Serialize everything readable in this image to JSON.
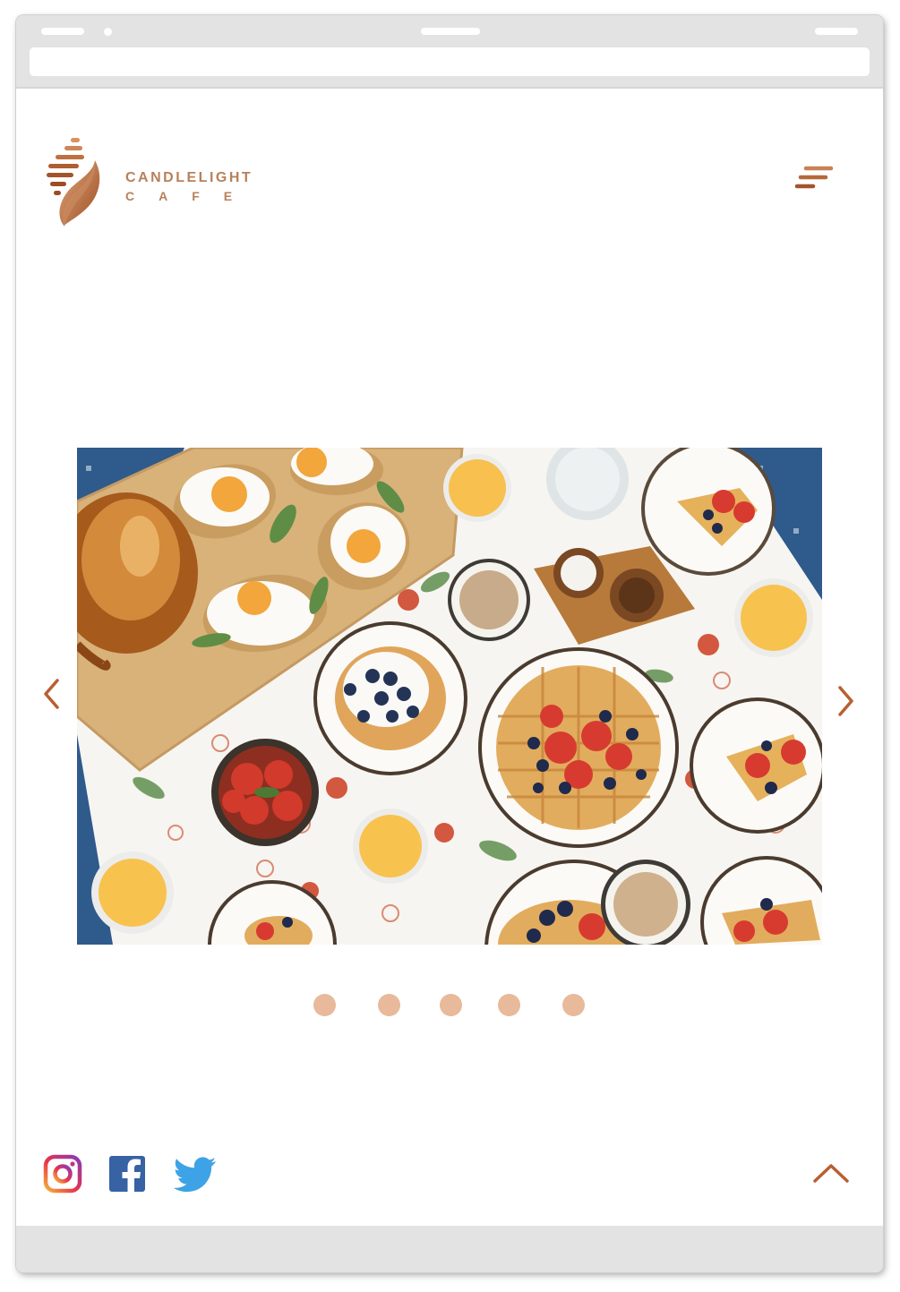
{
  "brand": {
    "name_line1": "CANDLELIGHT",
    "name_line2": "CAFE",
    "accent_color": "#b8815b",
    "dark_accent": "#a0552a"
  },
  "header": {
    "menu_icon": "hamburger-menu-icon"
  },
  "carousel": {
    "prev_icon": "chevron-left-icon",
    "next_icon": "chevron-right-icon",
    "slide_count": 5,
    "dot_color": "#e8b99a"
  },
  "footer": {
    "social": [
      "instagram-icon",
      "facebook-icon",
      "twitter-icon"
    ],
    "scroll_top_icon": "chevron-up-icon"
  }
}
